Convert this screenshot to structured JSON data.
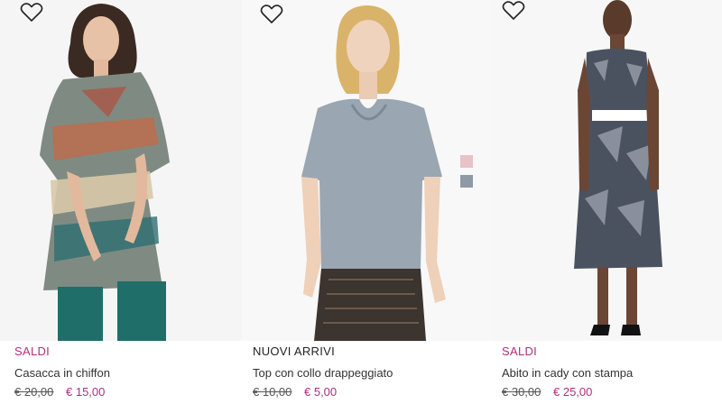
{
  "products": [
    {
      "badge": "SALDI",
      "title": "Casacca in chiffon",
      "old_price": "€ 20,00",
      "price": "€ 15,00"
    },
    {
      "badge": "NUOVI ARRIVI",
      "title": "Top con collo drappeggiato",
      "old_price": "€ 10,00",
      "price": "€ 5,00",
      "swatches": [
        "#e8c2c6",
        "#8f9aa6"
      ]
    },
    {
      "badge": "SALDI",
      "title": "Abito in cady con stampa",
      "old_price": "€ 30,00",
      "price": "€ 25,00"
    }
  ],
  "colors": {
    "sale": "#b02f7c"
  },
  "icons": {
    "wishlist": "heart-outline-icon"
  }
}
